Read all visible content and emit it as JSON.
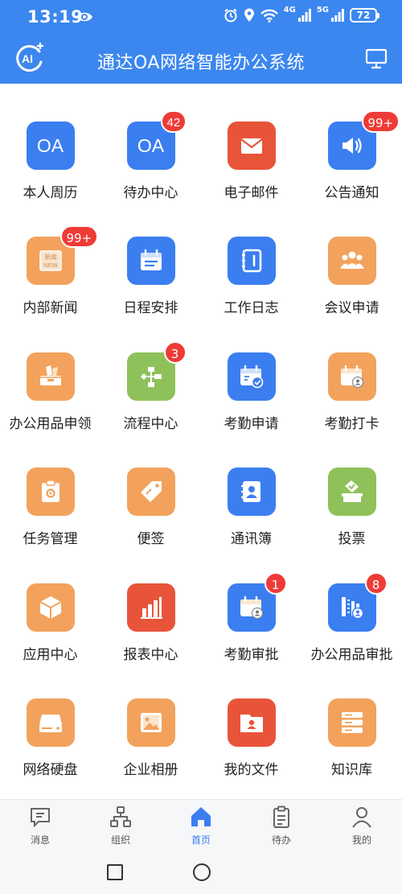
{
  "status_bar": {
    "time": "13:19",
    "net1": "4G",
    "net2": "5G",
    "battery": "72"
  },
  "header": {
    "logo_text": "AI",
    "title": "通达OA网络智能办公系统"
  },
  "apps": [
    {
      "label": "本人周历",
      "icon": "oa-text-icon",
      "color": "#3b7ef0",
      "tile_text": "OA",
      "badge": ""
    },
    {
      "label": "待办中心",
      "icon": "oa-text-icon",
      "color": "#3b7ef0",
      "tile_text": "OA",
      "badge": "42"
    },
    {
      "label": "电子邮件",
      "icon": "envelope-icon",
      "color": "#e8543a",
      "tile_text": "",
      "badge": ""
    },
    {
      "label": "公告通知",
      "icon": "speaker-icon",
      "color": "#3b7ef0",
      "tile_text": "",
      "badge": "99+"
    },
    {
      "label": "内部新闻",
      "icon": "newspaper-icon",
      "color": "#f2a25c",
      "tile_text": "",
      "badge": "99+"
    },
    {
      "label": "日程安排",
      "icon": "calendar-list-icon",
      "color": "#3b7ef0",
      "tile_text": "",
      "badge": ""
    },
    {
      "label": "工作日志",
      "icon": "notebook-icon",
      "color": "#3b7ef0",
      "tile_text": "",
      "badge": ""
    },
    {
      "label": "会议申请",
      "icon": "people-group-icon",
      "color": "#f2a25c",
      "tile_text": "",
      "badge": ""
    },
    {
      "label": "办公用品申领",
      "icon": "supplies-box-icon",
      "color": "#f2a25c",
      "tile_text": "",
      "badge": ""
    },
    {
      "label": "流程中心",
      "icon": "flow-chart-icon",
      "color": "#8fc15a",
      "tile_text": "",
      "badge": "3"
    },
    {
      "label": "考勤申请",
      "icon": "calendar-check-icon",
      "color": "#3b7ef0",
      "tile_text": "",
      "badge": ""
    },
    {
      "label": "考勤打卡",
      "icon": "calendar-person-icon",
      "color": "#f2a25c",
      "tile_text": "",
      "badge": ""
    },
    {
      "label": "任务管理",
      "icon": "clipboard-gear-icon",
      "color": "#f2a25c",
      "tile_text": "",
      "badge": ""
    },
    {
      "label": "便签",
      "icon": "tag-icon",
      "color": "#f2a25c",
      "tile_text": "",
      "badge": ""
    },
    {
      "label": "通讯簿",
      "icon": "contact-book-icon",
      "color": "#3b7ef0",
      "tile_text": "",
      "badge": ""
    },
    {
      "label": "投票",
      "icon": "ballot-box-icon",
      "color": "#8fc15a",
      "tile_text": "",
      "badge": ""
    },
    {
      "label": "应用中心",
      "icon": "cube-icon",
      "color": "#f2a25c",
      "tile_text": "",
      "badge": ""
    },
    {
      "label": "报表中心",
      "icon": "bar-chart-icon",
      "color": "#e8543a",
      "tile_text": "",
      "badge": ""
    },
    {
      "label": "考勤审批",
      "icon": "calendar-person-icon",
      "color": "#3b7ef0",
      "tile_text": "",
      "badge": "1"
    },
    {
      "label": "办公用品审批",
      "icon": "ruler-person-icon",
      "color": "#3b7ef0",
      "tile_text": "",
      "badge": "8"
    },
    {
      "label": "网络硬盘",
      "icon": "hard-drive-icon",
      "color": "#f2a25c",
      "tile_text": "",
      "badge": ""
    },
    {
      "label": "企业相册",
      "icon": "photo-icon",
      "color": "#f2a25c",
      "tile_text": "",
      "badge": ""
    },
    {
      "label": "我的文件",
      "icon": "folder-person-icon",
      "color": "#e8543a",
      "tile_text": "",
      "badge": ""
    },
    {
      "label": "知识库",
      "icon": "server-stack-icon",
      "color": "#f2a25c",
      "tile_text": "",
      "badge": ""
    }
  ],
  "nav": [
    {
      "label": "消息",
      "icon": "message-icon",
      "active": false
    },
    {
      "label": "组织",
      "icon": "org-tree-icon",
      "active": false
    },
    {
      "label": "首页",
      "icon": "home-icon",
      "active": true
    },
    {
      "label": "待办",
      "icon": "clipboard-icon",
      "active": false
    },
    {
      "label": "我的",
      "icon": "user-icon",
      "active": false
    }
  ],
  "colors": {
    "header_bg": "#3b87ef",
    "accent": "#3b7ef0",
    "badge": "#ee3b36"
  }
}
